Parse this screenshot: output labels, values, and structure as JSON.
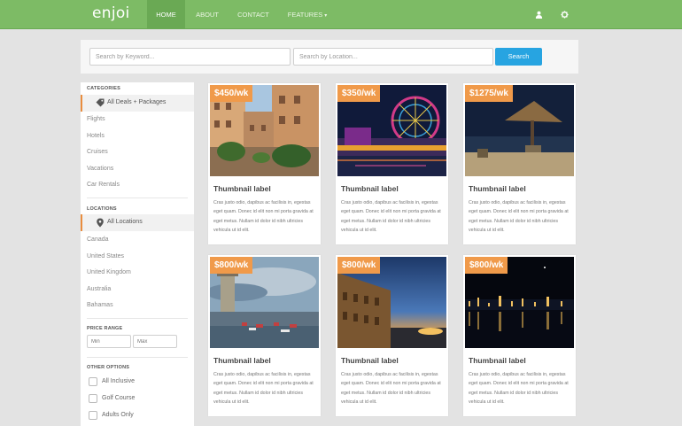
{
  "brand": "enjoi",
  "nav": {
    "items": [
      {
        "label": "HOME",
        "active": true
      },
      {
        "label": "ABOUT",
        "active": false
      },
      {
        "label": "CONTACT",
        "active": false
      },
      {
        "label": "FEATURES",
        "active": false
      }
    ],
    "features_caret": "▾",
    "icons": [
      "user-icon",
      "gear-icon"
    ]
  },
  "search": {
    "keyword_placeholder": "Search by Keyword...",
    "location_placeholder": "Search by Location...",
    "button_label": "Search",
    "button_color": "#27a4e1"
  },
  "sidebar": {
    "categories_header": "CATEGORIES",
    "categories": [
      "All Deals + Packages",
      "Flights",
      "Hotels",
      "Cruises",
      "Vacations",
      "Car Rentals"
    ],
    "locations_header": "LOCATIONS",
    "locations": [
      "All Locations",
      "Canada",
      "United States",
      "United Kingdom",
      "Australia",
      "Bahamas"
    ],
    "price_header": "PRICE RANGE",
    "price_min_placeholder": "Min",
    "price_max_placeholder": "Max",
    "options_header": "OTHER OPTIONS",
    "options": [
      "All Inclusive",
      "Golf Course",
      "Adults Only"
    ]
  },
  "cards": [
    {
      "price": "$450/wk",
      "title": "Thumbnail label",
      "text": "Cras justo odio, dapibus ac facilisis in, egestas eget quam. Donec id elit non mi porta gravida at eget metus. Nullam id dolor id nibh ultricies vehicula ut id elit."
    },
    {
      "price": "$350/wk",
      "title": "Thumbnail label",
      "text": "Cras justo odio, dapibus ac facilisis in, egestas eget quam. Donec id elit non mi porta gravida at eget metus. Nullam id dolor id nibh ultricies vehicula ut id elit."
    },
    {
      "price": "$1275/wk",
      "title": "Thumbnail label",
      "text": "Cras justo odio, dapibus ac facilisis in, egestas eget quam. Donec id elit non mi porta gravida at eget metus. Nullam id dolor id nibh ultricies vehicula ut id elit."
    },
    {
      "price": "$800/wk",
      "title": "Thumbnail label",
      "text": "Cras justo odio, dapibus ac facilisis in, egestas eget quam. Donec id elit non mi porta gravida at eget metus. Nullam id dolor id nibh ultricies vehicula ut id elit."
    },
    {
      "price": "$800/wk",
      "title": "Thumbnail label",
      "text": "Cras justo odio, dapibus ac facilisis in, egestas eget quam. Donec id elit non mi porta gravida at eget metus. Nullam id dolor id nibh ultricies vehicula ut id elit."
    },
    {
      "price": "$800/wk",
      "title": "Thumbnail label",
      "text": "Cras justo odio, dapibus ac facilisis in, egestas eget quam. Donec id elit non mi porta gravida at eget metus. Nullam id dolor id nibh ultricies vehicula ut id elit."
    }
  ],
  "colors": {
    "navbar": "#7dbb65",
    "price_tag": "#f09a4a",
    "accent_border": "#e98d3f"
  }
}
